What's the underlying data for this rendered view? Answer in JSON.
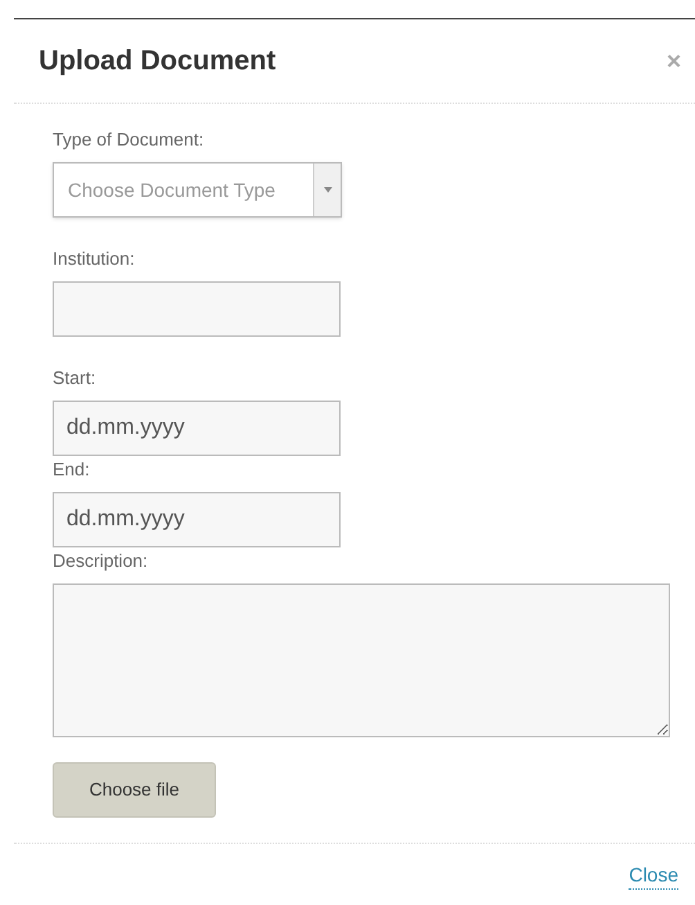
{
  "dialog": {
    "title": "Upload Document",
    "close_icon": "×"
  },
  "fields": [
    {
      "kind": "select",
      "label": "Type of Document:",
      "placeholder": "Choose Document Type"
    },
    {
      "kind": "text",
      "label": "Institution:"
    },
    {
      "kind": "text",
      "label": "Start:",
      "value": "dd.mm.yyyy"
    },
    {
      "kind": "text",
      "label": "End:",
      "value": "dd.mm.yyyy"
    },
    {
      "kind": "textarea",
      "label": "Description:"
    }
  ],
  "file_button": "Choose file",
  "footer_link": "Close"
}
